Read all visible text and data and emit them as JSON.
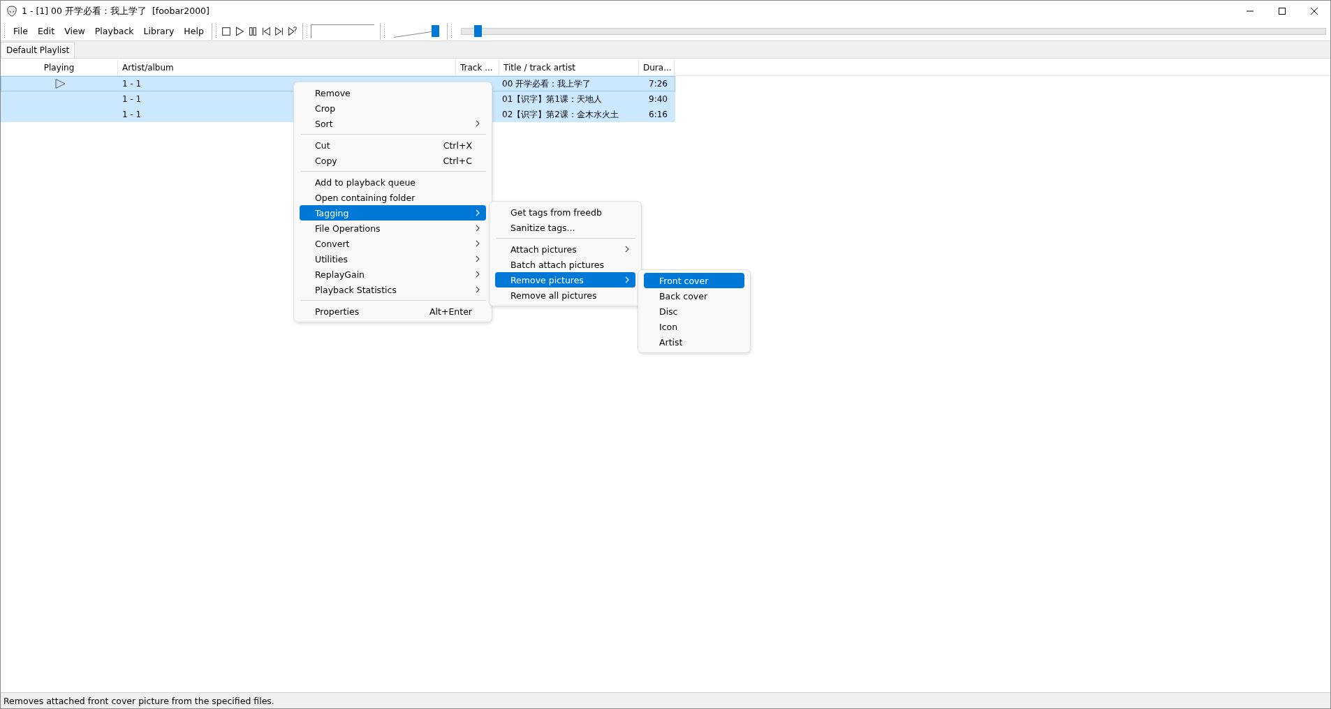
{
  "window": {
    "title": "1 - [1] 00 开学必看：我上学了  [foobar2000]"
  },
  "menu_bar": [
    "File",
    "Edit",
    "View",
    "Playback",
    "Library",
    "Help"
  ],
  "toolbar": {
    "buttons": [
      {
        "kind": "stop"
      },
      {
        "kind": "play"
      },
      {
        "kind": "pause"
      },
      {
        "kind": "previous"
      },
      {
        "kind": "next"
      },
      {
        "kind": "random"
      }
    ],
    "volume": {
      "level": 1.0
    },
    "seek": {
      "level": 0.01
    }
  },
  "tabs": [
    {
      "label": "Default Playlist",
      "selected": true
    }
  ],
  "playlist": {
    "columns": [
      "Playing",
      "Artist/album",
      "Track ...",
      "Title / track artist",
      "Dura..."
    ],
    "rows": [
      {
        "playing": true,
        "focused": true,
        "selected": true,
        "artist_album": "1 - 1",
        "title": "00 开学必看：我上学了",
        "duration": "7:26"
      },
      {
        "playing": false,
        "focused": false,
        "selected": true,
        "artist_album": "1 - 1",
        "title": "01【识字】第1课：天地人",
        "duration": "9:40"
      },
      {
        "playing": false,
        "focused": false,
        "selected": true,
        "artist_album": "1 - 1",
        "title": "02【识字】第2课：金木水火土",
        "duration": "6:16"
      }
    ]
  },
  "context_menu": {
    "items": [
      {
        "kind": "item",
        "label": "Remove",
        "submenu": false,
        "selected": false
      },
      {
        "kind": "item",
        "label": "Crop",
        "submenu": false,
        "selected": false
      },
      {
        "kind": "item",
        "label": "Sort",
        "submenu": true,
        "selected": false
      },
      {
        "kind": "separator"
      },
      {
        "kind": "item",
        "label": "Cut",
        "shortcut": "Ctrl+X",
        "submenu": false,
        "selected": false
      },
      {
        "kind": "item",
        "label": "Copy",
        "shortcut": "Ctrl+C",
        "submenu": false,
        "selected": false
      },
      {
        "kind": "separator"
      },
      {
        "kind": "item",
        "label": "Add to playback queue",
        "submenu": false,
        "selected": false
      },
      {
        "kind": "item",
        "label": "Open containing folder",
        "submenu": false,
        "selected": false
      },
      {
        "kind": "item",
        "label": "Tagging",
        "submenu": true,
        "selected": true
      },
      {
        "kind": "item",
        "label": "File Operations",
        "submenu": true,
        "selected": false
      },
      {
        "kind": "item",
        "label": "Convert",
        "submenu": true,
        "selected": false
      },
      {
        "kind": "item",
        "label": "Utilities",
        "submenu": true,
        "selected": false
      },
      {
        "kind": "item",
        "label": "ReplayGain",
        "submenu": true,
        "selected": false
      },
      {
        "kind": "item",
        "label": "Playback Statistics",
        "submenu": true,
        "selected": false
      },
      {
        "kind": "separator"
      },
      {
        "kind": "item",
        "label": "Properties",
        "shortcut": "Alt+Enter",
        "submenu": false,
        "selected": false
      }
    ]
  },
  "tagging_submenu": {
    "items": [
      {
        "kind": "item",
        "label": "Get tags from freedb",
        "submenu": false,
        "selected": false
      },
      {
        "kind": "item",
        "label": "Sanitize tags...",
        "submenu": false,
        "selected": false
      },
      {
        "kind": "separator"
      },
      {
        "kind": "item",
        "label": "Attach pictures",
        "submenu": true,
        "selected": false
      },
      {
        "kind": "item",
        "label": "Batch attach pictures",
        "submenu": false,
        "selected": false
      },
      {
        "kind": "item",
        "label": "Remove pictures",
        "submenu": true,
        "selected": true
      },
      {
        "kind": "item",
        "label": "Remove all pictures",
        "submenu": false,
        "selected": false
      }
    ]
  },
  "remove_pictures_submenu": {
    "items": [
      {
        "kind": "item",
        "label": "Front cover",
        "submenu": false,
        "selected": true
      },
      {
        "kind": "item",
        "label": "Back cover",
        "submenu": false,
        "selected": false
      },
      {
        "kind": "item",
        "label": "Disc",
        "submenu": false,
        "selected": false
      },
      {
        "kind": "item",
        "label": "Icon",
        "submenu": false,
        "selected": false
      },
      {
        "kind": "item",
        "label": "Artist",
        "submenu": false,
        "selected": false
      }
    ]
  },
  "status_bar": "Removes attached front cover picture from the specified files."
}
